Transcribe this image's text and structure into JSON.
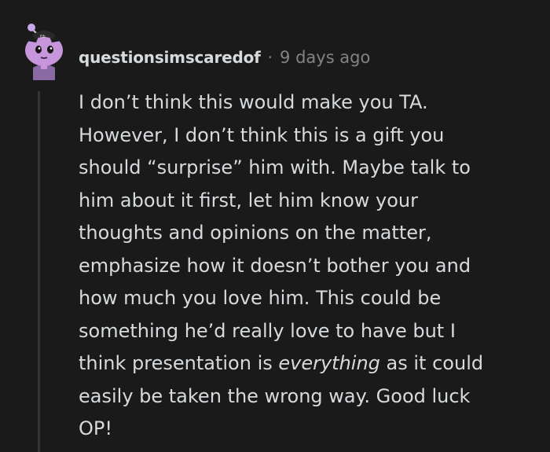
{
  "comment": {
    "username": "questionsimscaredof",
    "separator": "·",
    "timestamp": "9 days ago",
    "avatar_icon": "snoo-avatar-icon",
    "colors": {
      "background": "#1a1a1b",
      "text": "#d7dadc",
      "muted": "#818384",
      "thread_line": "#343536",
      "avatar_body": "#bf8bd6"
    },
    "body": {
      "line_1": "I don’t think this would make you TA.",
      "line_2": "However, I don’t think this is a gift you",
      "line_3": "should “surprise” him with. Maybe talk to",
      "line_4": "him about it first, let him know your",
      "line_5": "thoughts and opinions on the matter,",
      "line_6": "emphasize how it doesn’t bother you and",
      "line_7": "how much you love him. This could be",
      "line_8": "something he’d really love to have but I",
      "line_9_before": "think presentation is ",
      "line_9_emphasis": "everything",
      "line_9_after": " as it could",
      "line_10": "easily be taken the wrong way. Good luck",
      "line_11": "OP!"
    }
  }
}
